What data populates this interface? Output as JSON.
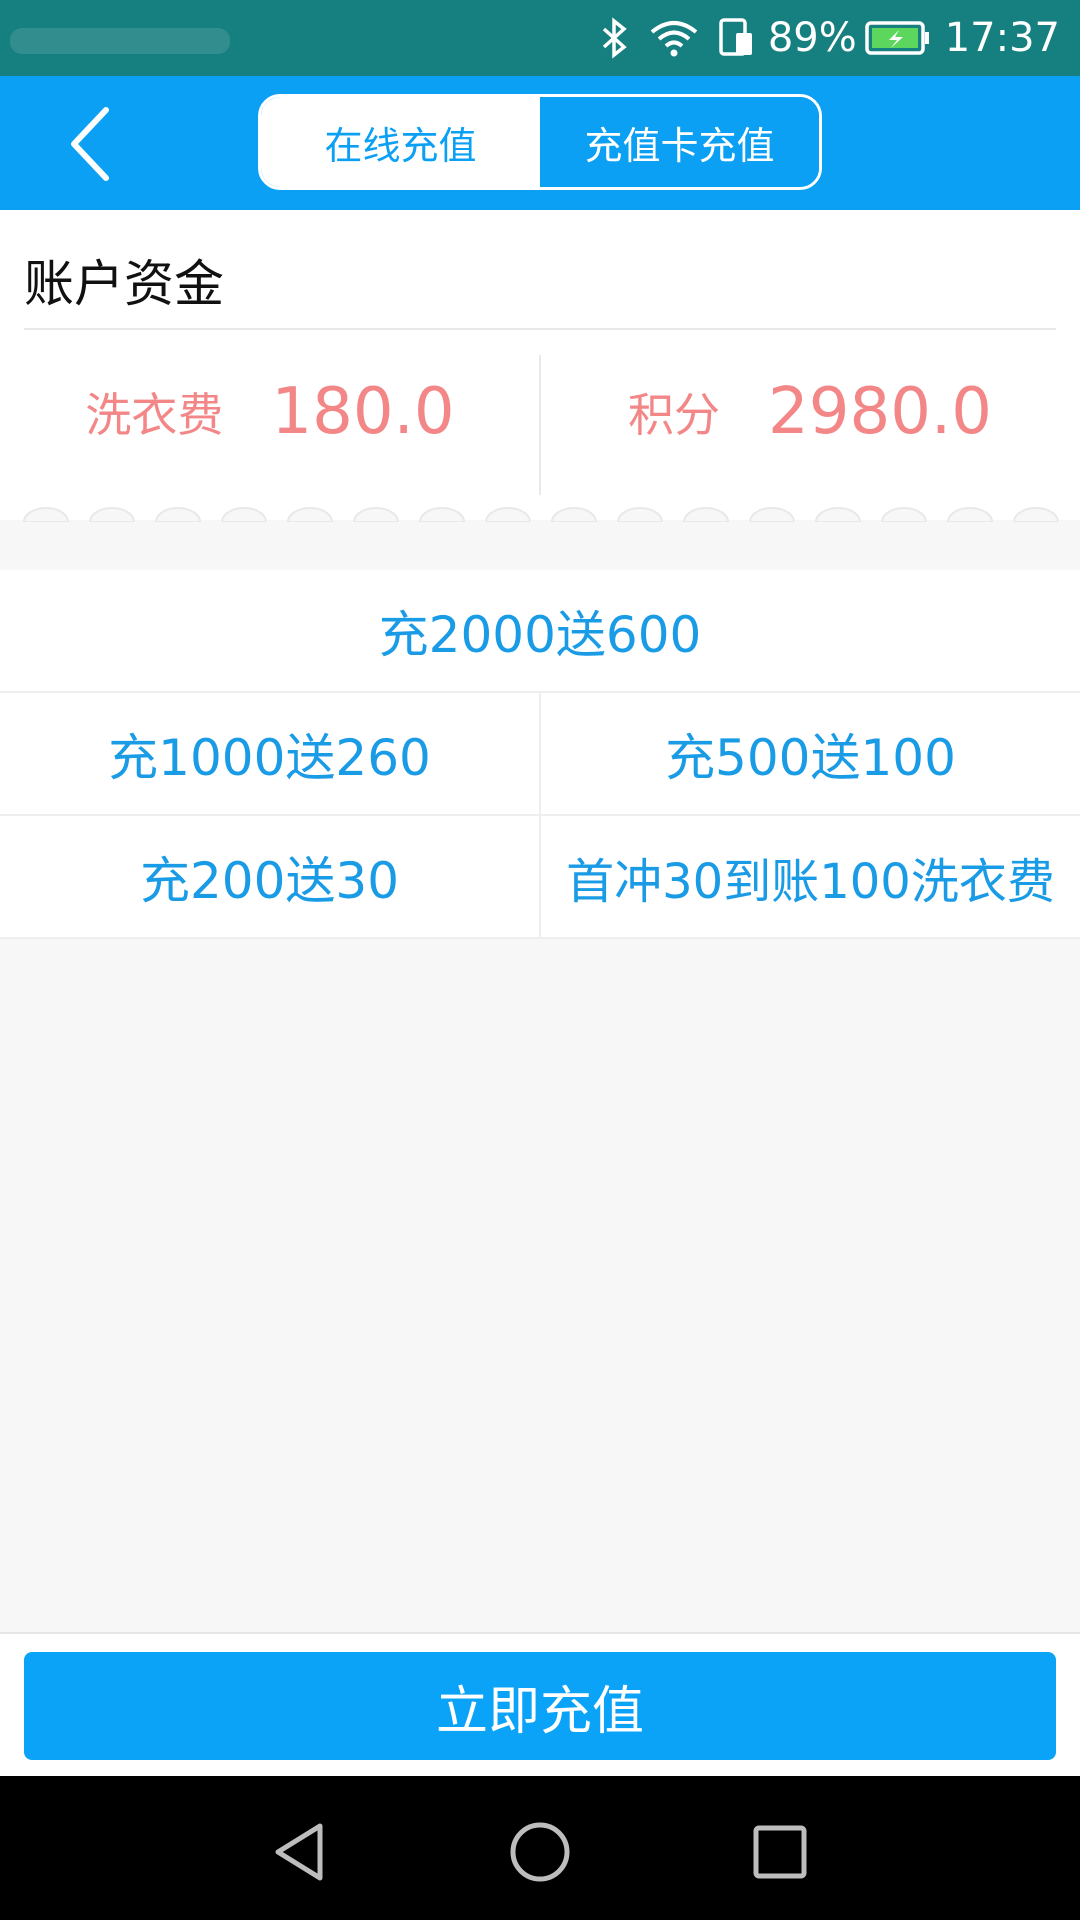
{
  "status_bar": {
    "battery_percent": "89%",
    "time": "17:37",
    "icons": [
      "bluetooth-icon",
      "wifi-icon",
      "sim-icon",
      "battery-icon"
    ]
  },
  "header": {
    "tabs": [
      {
        "label": "在线充值",
        "active": true
      },
      {
        "label": "充值卡充值",
        "active": false
      }
    ],
    "colors": {
      "primary": "#0ba0f4",
      "status": "#167f7f"
    }
  },
  "account": {
    "title": "账户资金",
    "laundry_fee": {
      "label": "洗衣费",
      "value": "180.0"
    },
    "points": {
      "label": "积分",
      "value": "2980.0"
    },
    "value_color": "#f38787"
  },
  "packages": {
    "top": "充2000送600",
    "row2": [
      "充1000送260",
      "充500送100"
    ],
    "row3": [
      "充200送30",
      "首冲30到账100洗衣费"
    ]
  },
  "action": {
    "recharge_label": "立即充值"
  }
}
